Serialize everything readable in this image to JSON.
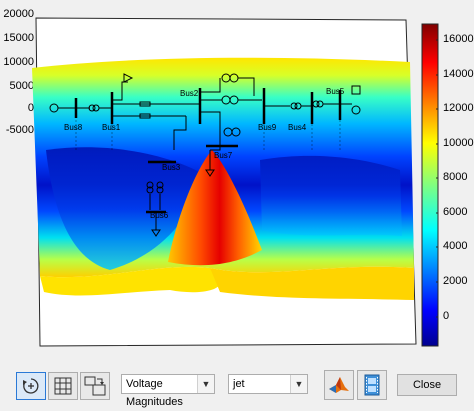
{
  "plot": {
    "y_ticks": [
      "20000",
      "15000",
      "10000",
      "5000",
      "0",
      "-5000"
    ],
    "colorbar_ticks": [
      "16000",
      "14000",
      "12000",
      "10000",
      "8000",
      "6000",
      "4000",
      "2000",
      "0"
    ],
    "colormap": "jet",
    "buses": [
      "Bus8",
      "Bus1",
      "Bus2",
      "Bus3",
      "Bus6",
      "Bus7",
      "Bus9",
      "Bus4",
      "Bus5"
    ]
  },
  "toolbar": {
    "measure_dropdown": "Voltage Magnitudes",
    "colormap_dropdown": "jet",
    "close_label": "Close"
  }
}
